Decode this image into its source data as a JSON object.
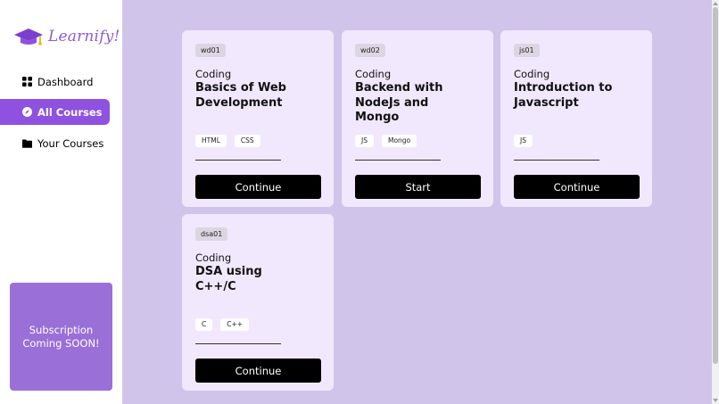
{
  "app": {
    "name": "Learnify!",
    "brand_color": "#8e51e0"
  },
  "sidebar": {
    "items": [
      {
        "label": "Dashboard",
        "icon": "grid-icon",
        "active": false
      },
      {
        "label": "All Courses",
        "icon": "compass-icon",
        "active": true
      },
      {
        "label": "Your Courses",
        "icon": "folder-icon",
        "active": false
      }
    ],
    "promo": {
      "line1": "Subscription",
      "line2": "Coming SOON!"
    }
  },
  "courses": [
    {
      "code": "wd01",
      "category": "Coding",
      "title": "Basics of Web Development",
      "tags": [
        "HTML",
        "CSS"
      ],
      "action": "Continue"
    },
    {
      "code": "wd02",
      "category": "Coding",
      "title": "Backend with NodeJs and Mongo",
      "tags": [
        "JS",
        "Mongo"
      ],
      "action": "Start"
    },
    {
      "code": "js01",
      "category": "Coding",
      "title": "Introduction to Javascript",
      "tags": [
        "JS"
      ],
      "action": "Continue"
    },
    {
      "code": "dsa01",
      "category": "Coding",
      "title": "DSA using C++/C",
      "tags": [
        "C",
        "C++"
      ],
      "action": "Continue"
    }
  ]
}
